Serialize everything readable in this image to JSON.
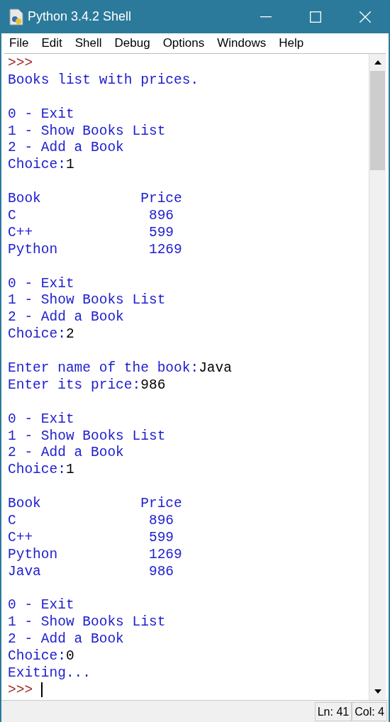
{
  "window": {
    "title": "Python 3.4.2 Shell"
  },
  "menu": [
    "File",
    "Edit",
    "Shell",
    "Debug",
    "Options",
    "Windows",
    "Help"
  ],
  "lines": [
    {
      "kind": "text",
      "segments": [
        {
          "kind": "prompt",
          "text": ">>>"
        }
      ]
    },
    {
      "kind": "text",
      "segments": [
        {
          "kind": "output",
          "text": "Books list with prices."
        }
      ]
    },
    {
      "kind": "blank"
    },
    {
      "kind": "text",
      "segments": [
        {
          "kind": "output",
          "text": "0 - Exit"
        }
      ]
    },
    {
      "kind": "text",
      "segments": [
        {
          "kind": "output",
          "text": "1 - Show Books List"
        }
      ]
    },
    {
      "kind": "text",
      "segments": [
        {
          "kind": "output",
          "text": "2 - Add a Book"
        }
      ]
    },
    {
      "kind": "text",
      "segments": [
        {
          "kind": "output",
          "text": "Choice:"
        },
        {
          "kind": "input",
          "text": "1"
        }
      ]
    },
    {
      "kind": "blank"
    },
    {
      "kind": "text",
      "segments": [
        {
          "kind": "output",
          "text": "Book            Price"
        }
      ]
    },
    {
      "kind": "text",
      "segments": [
        {
          "kind": "output",
          "text": "C                896"
        }
      ]
    },
    {
      "kind": "text",
      "segments": [
        {
          "kind": "output",
          "text": "C++              599"
        }
      ]
    },
    {
      "kind": "text",
      "segments": [
        {
          "kind": "output",
          "text": "Python           1269"
        }
      ]
    },
    {
      "kind": "blank"
    },
    {
      "kind": "text",
      "segments": [
        {
          "kind": "output",
          "text": "0 - Exit"
        }
      ]
    },
    {
      "kind": "text",
      "segments": [
        {
          "kind": "output",
          "text": "1 - Show Books List"
        }
      ]
    },
    {
      "kind": "text",
      "segments": [
        {
          "kind": "output",
          "text": "2 - Add a Book"
        }
      ]
    },
    {
      "kind": "text",
      "segments": [
        {
          "kind": "output",
          "text": "Choice:"
        },
        {
          "kind": "input",
          "text": "2"
        }
      ]
    },
    {
      "kind": "blank"
    },
    {
      "kind": "text",
      "segments": [
        {
          "kind": "output",
          "text": "Enter name of the book:"
        },
        {
          "kind": "input",
          "text": "Java"
        }
      ]
    },
    {
      "kind": "text",
      "segments": [
        {
          "kind": "output",
          "text": "Enter its price:"
        },
        {
          "kind": "input",
          "text": "986"
        }
      ]
    },
    {
      "kind": "blank"
    },
    {
      "kind": "text",
      "segments": [
        {
          "kind": "output",
          "text": "0 - Exit"
        }
      ]
    },
    {
      "kind": "text",
      "segments": [
        {
          "kind": "output",
          "text": "1 - Show Books List"
        }
      ]
    },
    {
      "kind": "text",
      "segments": [
        {
          "kind": "output",
          "text": "2 - Add a Book"
        }
      ]
    },
    {
      "kind": "text",
      "segments": [
        {
          "kind": "output",
          "text": "Choice:"
        },
        {
          "kind": "input",
          "text": "1"
        }
      ]
    },
    {
      "kind": "blank"
    },
    {
      "kind": "text",
      "segments": [
        {
          "kind": "output",
          "text": "Book            Price"
        }
      ]
    },
    {
      "kind": "text",
      "segments": [
        {
          "kind": "output",
          "text": "C                896"
        }
      ]
    },
    {
      "kind": "text",
      "segments": [
        {
          "kind": "output",
          "text": "C++              599"
        }
      ]
    },
    {
      "kind": "text",
      "segments": [
        {
          "kind": "output",
          "text": "Python           1269"
        }
      ]
    },
    {
      "kind": "text",
      "segments": [
        {
          "kind": "output",
          "text": "Java             986"
        }
      ]
    },
    {
      "kind": "blank"
    },
    {
      "kind": "text",
      "segments": [
        {
          "kind": "output",
          "text": "0 - Exit"
        }
      ]
    },
    {
      "kind": "text",
      "segments": [
        {
          "kind": "output",
          "text": "1 - Show Books List"
        }
      ]
    },
    {
      "kind": "text",
      "segments": [
        {
          "kind": "output",
          "text": "2 - Add a Book"
        }
      ]
    },
    {
      "kind": "text",
      "segments": [
        {
          "kind": "output",
          "text": "Choice:"
        },
        {
          "kind": "input",
          "text": "0"
        }
      ]
    },
    {
      "kind": "text",
      "segments": [
        {
          "kind": "output",
          "text": "Exiting..."
        }
      ]
    },
    {
      "kind": "text",
      "segments": [
        {
          "kind": "prompt",
          "text": ">>> "
        }
      ],
      "cursor": true
    }
  ],
  "status_bar": {
    "line": "Ln: 41",
    "column": "Col: 4"
  }
}
